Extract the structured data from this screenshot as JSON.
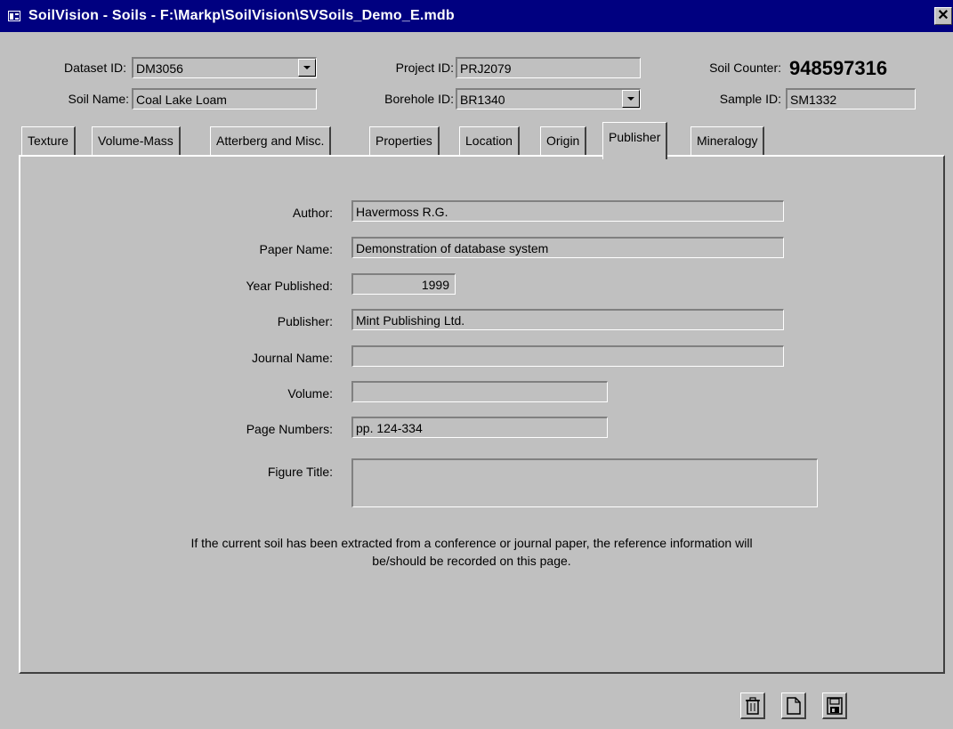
{
  "window": {
    "title": "SoilVision - Soils - F:\\Markp\\SoilVision\\SVSoils_Demo_E.mdb",
    "close_symbol": "✕"
  },
  "header": {
    "dataset_id_label": "Dataset ID:",
    "dataset_id_value": "DM3056",
    "soil_name_label": "Soil Name:",
    "soil_name_value": "Coal Lake Loam",
    "project_id_label": "Project ID:",
    "project_id_value": "PRJ2079",
    "borehole_id_label": "Borehole ID:",
    "borehole_id_value": "BR1340",
    "soil_counter_label": "Soil Counter:",
    "soil_counter_value": "948597316",
    "sample_id_label": "Sample ID:",
    "sample_id_value": "SM1332"
  },
  "tabs": [
    {
      "label": "Texture"
    },
    {
      "label": "Volume-Mass"
    },
    {
      "label": "Atterberg and Misc."
    },
    {
      "label": "Properties"
    },
    {
      "label": "Location"
    },
    {
      "label": "Origin"
    },
    {
      "label": "Publisher",
      "active": true
    },
    {
      "label": "Mineralogy"
    }
  ],
  "publisher": {
    "author_label": "Author:",
    "author_value": "Havermoss R.G.",
    "paper_name_label": "Paper Name:",
    "paper_name_value": "Demonstration of database system",
    "year_label": "Year Published:",
    "year_value": "1999",
    "publisher_label": "Publisher:",
    "publisher_value": "Mint Publishing Ltd.",
    "journal_label": "Journal Name:",
    "journal_value": "",
    "volume_label": "Volume:",
    "volume_value": "",
    "pages_label": "Page Numbers:",
    "pages_value": "pp. 124-334",
    "figure_title_label": "Figure Title:",
    "figure_title_value": "",
    "info_line1": "If the current soil has been extracted from a conference or journal paper, the reference information will",
    "info_line2": "be/should be recorded on this page."
  },
  "toolbar": {
    "delete_icon": "trash-icon",
    "new_icon": "new-record-icon",
    "save_icon": "save-icon"
  }
}
